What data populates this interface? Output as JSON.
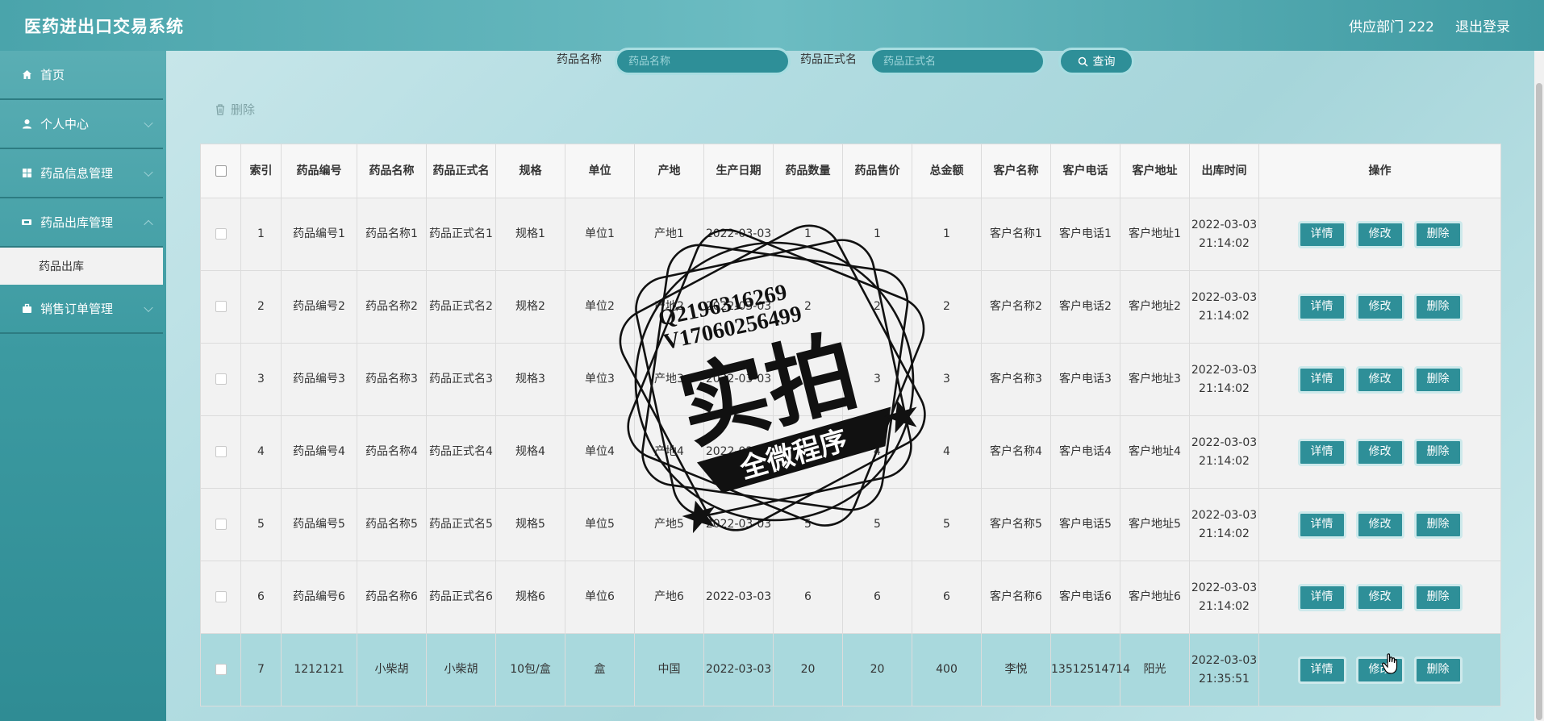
{
  "header": {
    "title": "医药进出口交易系统",
    "user": "供应部门 222",
    "logout": "退出登录"
  },
  "sidebar": {
    "items": [
      {
        "label": "首页",
        "icon": "home-icon"
      },
      {
        "label": "个人中心",
        "icon": "user-icon"
      },
      {
        "label": "药品信息管理",
        "icon": "grid-icon"
      },
      {
        "label": "药品出库管理",
        "icon": "truck-icon"
      },
      {
        "label": "销售订单管理",
        "icon": "briefcase-icon"
      }
    ],
    "submenu": {
      "label": "药品出库"
    }
  },
  "search": {
    "name_label": "药品名称",
    "name_placeholder": "药品名称",
    "formal_label": "药品正式名",
    "formal_placeholder": "药品正式名",
    "query_label": "查询"
  },
  "toolbar": {
    "delete_label": "删除"
  },
  "table": {
    "columns": [
      "索引",
      "药品编号",
      "药品名称",
      "药品正式名",
      "规格",
      "单位",
      "产地",
      "生产日期",
      "药品数量",
      "药品售价",
      "总金额",
      "客户名称",
      "客户电话",
      "客户地址",
      "出库时间",
      "操作"
    ],
    "rows": [
      {
        "index": "1",
        "code": "药品编号1",
        "name": "药品名称1",
        "formal": "药品正式名1",
        "spec": "规格1",
        "unit": "单位1",
        "origin": "产地1",
        "date": "2022-03-03",
        "qty": "1",
        "price": "1",
        "total": "1",
        "customer": "客户名称1",
        "phone": "客户电话1",
        "address": "客户地址1",
        "out_time": "2022-03-03 21:14:02"
      },
      {
        "index": "2",
        "code": "药品编号2",
        "name": "药品名称2",
        "formal": "药品正式名2",
        "spec": "规格2",
        "unit": "单位2",
        "origin": "产地2",
        "date": "2022-03-03",
        "qty": "2",
        "price": "2",
        "total": "2",
        "customer": "客户名称2",
        "phone": "客户电话2",
        "address": "客户地址2",
        "out_time": "2022-03-03 21:14:02"
      },
      {
        "index": "3",
        "code": "药品编号3",
        "name": "药品名称3",
        "formal": "药品正式名3",
        "spec": "规格3",
        "unit": "单位3",
        "origin": "产地3",
        "date": "2022-03-03",
        "qty": "3",
        "price": "3",
        "total": "3",
        "customer": "客户名称3",
        "phone": "客户电话3",
        "address": "客户地址3",
        "out_time": "2022-03-03 21:14:02"
      },
      {
        "index": "4",
        "code": "药品编号4",
        "name": "药品名称4",
        "formal": "药品正式名4",
        "spec": "规格4",
        "unit": "单位4",
        "origin": "产地4",
        "date": "2022-03-03",
        "qty": "4",
        "price": "4",
        "total": "4",
        "customer": "客户名称4",
        "phone": "客户电话4",
        "address": "客户地址4",
        "out_time": "2022-03-03 21:14:02"
      },
      {
        "index": "5",
        "code": "药品编号5",
        "name": "药品名称5",
        "formal": "药品正式名5",
        "spec": "规格5",
        "unit": "单位5",
        "origin": "产地5",
        "date": "2022-03-03",
        "qty": "5",
        "price": "5",
        "total": "5",
        "customer": "客户名称5",
        "phone": "客户电话5",
        "address": "客户地址5",
        "out_time": "2022-03-03 21:14:02"
      },
      {
        "index": "6",
        "code": "药品编号6",
        "name": "药品名称6",
        "formal": "药品正式名6",
        "spec": "规格6",
        "unit": "单位6",
        "origin": "产地6",
        "date": "2022-03-03",
        "qty": "6",
        "price": "6",
        "total": "6",
        "customer": "客户名称6",
        "phone": "客户电话6",
        "address": "客户地址6",
        "out_time": "2022-03-03 21:14:02"
      },
      {
        "index": "7",
        "code": "1212121",
        "name": "小柴胡",
        "formal": "小柴胡",
        "spec": "10包/盒",
        "unit": "盒",
        "origin": "中国",
        "date": "2022-03-03",
        "qty": "20",
        "price": "20",
        "total": "400",
        "customer": "李悦",
        "phone": "13512514714",
        "address": "阳光",
        "out_time": "2022-03-03 21:35:51"
      }
    ],
    "actions": {
      "detail": "详情",
      "edit": "修改",
      "delete": "删除"
    }
  },
  "watermark": {
    "line1": "Q2196316269",
    "line2": "V17060256499",
    "main": "实拍",
    "banner": "全微程序"
  },
  "colors": {
    "accent": "#2e8f98",
    "header": "#5fb3b9",
    "highlight_row": "#a9d9dd"
  }
}
